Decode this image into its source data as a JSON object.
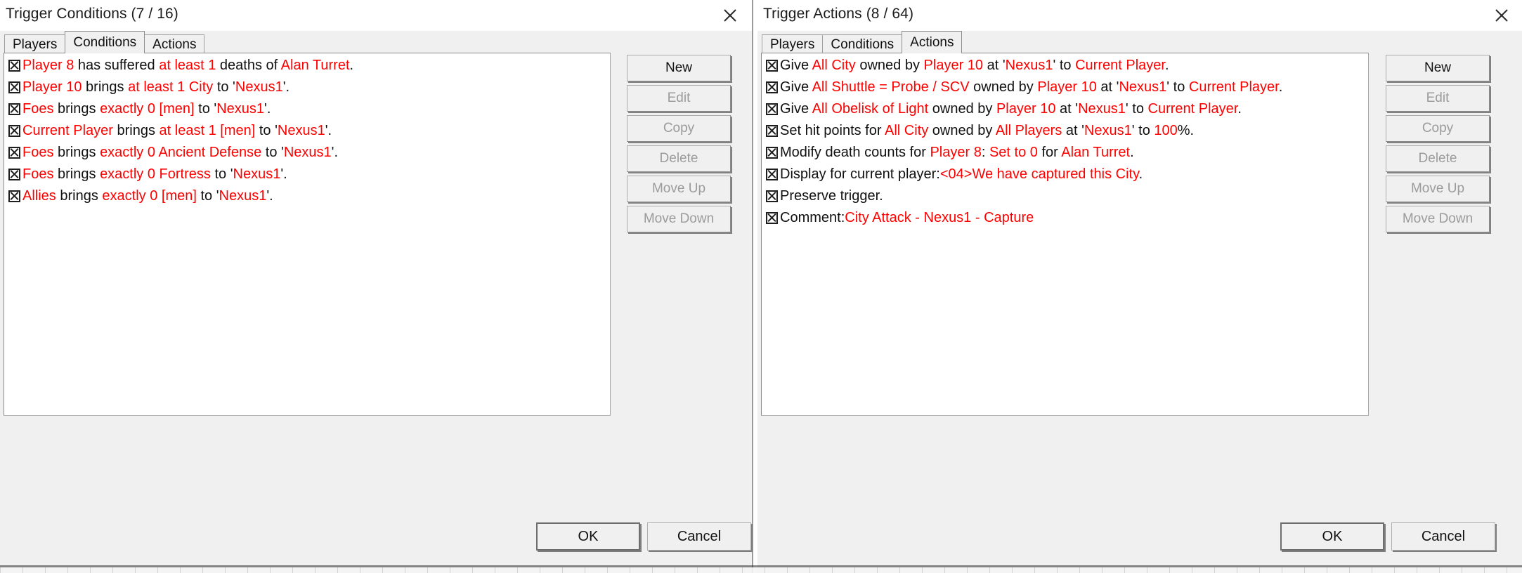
{
  "colors": {
    "accent_red": "#ff0000",
    "text": "#111111",
    "disabled_text": "#9b9b9b",
    "dialog_bg": "#f0f0f0",
    "list_bg": "#ffffff"
  },
  "conditions_dialog": {
    "title": "Trigger Conditions (7 / 16)",
    "close_label": "Close",
    "tabs": [
      {
        "label": "Players",
        "active": false
      },
      {
        "label": "Conditions",
        "active": true
      },
      {
        "label": "Actions",
        "active": false
      }
    ],
    "buttons": [
      {
        "label": "New",
        "enabled": true
      },
      {
        "label": "Edit",
        "enabled": false
      },
      {
        "label": "Copy",
        "enabled": false
      },
      {
        "label": "Delete",
        "enabled": false
      },
      {
        "label": "Move Up",
        "enabled": false
      },
      {
        "label": "Move Down",
        "enabled": false
      }
    ],
    "footer": {
      "ok": "OK",
      "cancel": "Cancel"
    },
    "rows": [
      {
        "checked": true,
        "parts": [
          {
            "t": "Player 8",
            "c": "r"
          },
          {
            "t": " has suffered ",
            "c": "k"
          },
          {
            "t": "at least",
            "c": "r"
          },
          {
            "t": " ",
            "c": "k"
          },
          {
            "t": "1",
            "c": "r"
          },
          {
            "t": " deaths of ",
            "c": "k"
          },
          {
            "t": "Alan Turret",
            "c": "r"
          },
          {
            "t": ".",
            "c": "k"
          }
        ]
      },
      {
        "checked": true,
        "parts": [
          {
            "t": "Player 10",
            "c": "r"
          },
          {
            "t": " brings ",
            "c": "k"
          },
          {
            "t": "at least",
            "c": "r"
          },
          {
            "t": " ",
            "c": "k"
          },
          {
            "t": "1 City",
            "c": "r"
          },
          {
            "t": " to '",
            "c": "k"
          },
          {
            "t": "Nexus1",
            "c": "r"
          },
          {
            "t": "'.",
            "c": "k"
          }
        ]
      },
      {
        "checked": true,
        "parts": [
          {
            "t": "Foes",
            "c": "r"
          },
          {
            "t": " brings ",
            "c": "k"
          },
          {
            "t": "exactly",
            "c": "r"
          },
          {
            "t": " ",
            "c": "k"
          },
          {
            "t": "0 [men]",
            "c": "r"
          },
          {
            "t": " to '",
            "c": "k"
          },
          {
            "t": "Nexus1",
            "c": "r"
          },
          {
            "t": "'.",
            "c": "k"
          }
        ]
      },
      {
        "checked": true,
        "parts": [
          {
            "t": "Current Player",
            "c": "r"
          },
          {
            "t": " brings ",
            "c": "k"
          },
          {
            "t": "at least",
            "c": "r"
          },
          {
            "t": " ",
            "c": "k"
          },
          {
            "t": "1 [men]",
            "c": "r"
          },
          {
            "t": " to '",
            "c": "k"
          },
          {
            "t": "Nexus1",
            "c": "r"
          },
          {
            "t": "'.",
            "c": "k"
          }
        ]
      },
      {
        "checked": true,
        "parts": [
          {
            "t": "Foes",
            "c": "r"
          },
          {
            "t": " brings ",
            "c": "k"
          },
          {
            "t": "exactly",
            "c": "r"
          },
          {
            "t": " ",
            "c": "k"
          },
          {
            "t": "0 Ancient Defense",
            "c": "r"
          },
          {
            "t": " to '",
            "c": "k"
          },
          {
            "t": "Nexus1",
            "c": "r"
          },
          {
            "t": "'.",
            "c": "k"
          }
        ]
      },
      {
        "checked": true,
        "parts": [
          {
            "t": "Foes",
            "c": "r"
          },
          {
            "t": " brings ",
            "c": "k"
          },
          {
            "t": "exactly",
            "c": "r"
          },
          {
            "t": " ",
            "c": "k"
          },
          {
            "t": "0 Fortress",
            "c": "r"
          },
          {
            "t": " to '",
            "c": "k"
          },
          {
            "t": "Nexus1",
            "c": "r"
          },
          {
            "t": "'.",
            "c": "k"
          }
        ]
      },
      {
        "checked": true,
        "parts": [
          {
            "t": "Allies",
            "c": "r"
          },
          {
            "t": " brings ",
            "c": "k"
          },
          {
            "t": "exactly",
            "c": "r"
          },
          {
            "t": " ",
            "c": "k"
          },
          {
            "t": "0 [men]",
            "c": "r"
          },
          {
            "t": " to '",
            "c": "k"
          },
          {
            "t": "Nexus1",
            "c": "r"
          },
          {
            "t": "'.",
            "c": "k"
          }
        ]
      }
    ]
  },
  "actions_dialog": {
    "title": "Trigger Actions (8 / 64)",
    "close_label": "Close",
    "tabs": [
      {
        "label": "Players",
        "active": false
      },
      {
        "label": "Conditions",
        "active": false
      },
      {
        "label": "Actions",
        "active": true
      }
    ],
    "buttons": [
      {
        "label": "New",
        "enabled": true
      },
      {
        "label": "Edit",
        "enabled": false
      },
      {
        "label": "Copy",
        "enabled": false
      },
      {
        "label": "Delete",
        "enabled": false
      },
      {
        "label": "Move Up",
        "enabled": false
      },
      {
        "label": "Move Down",
        "enabled": false
      }
    ],
    "footer": {
      "ok": "OK",
      "cancel": "Cancel"
    },
    "rows": [
      {
        "checked": true,
        "parts": [
          {
            "t": "Give ",
            "c": "k"
          },
          {
            "t": "All City",
            "c": "r"
          },
          {
            "t": " owned by ",
            "c": "k"
          },
          {
            "t": "Player 10",
            "c": "r"
          },
          {
            "t": " at '",
            "c": "k"
          },
          {
            "t": "Nexus1",
            "c": "r"
          },
          {
            "t": "' to ",
            "c": "k"
          },
          {
            "t": "Current Player",
            "c": "r"
          },
          {
            "t": ".",
            "c": "k"
          }
        ]
      },
      {
        "checked": true,
        "parts": [
          {
            "t": "Give ",
            "c": "k"
          },
          {
            "t": "All Shuttle = Probe / SCV",
            "c": "r"
          },
          {
            "t": " owned by ",
            "c": "k"
          },
          {
            "t": "Player 10",
            "c": "r"
          },
          {
            "t": " at '",
            "c": "k"
          },
          {
            "t": "Nexus1",
            "c": "r"
          },
          {
            "t": "' to ",
            "c": "k"
          },
          {
            "t": "Current Player",
            "c": "r"
          },
          {
            "t": ".",
            "c": "k"
          }
        ]
      },
      {
        "checked": true,
        "parts": [
          {
            "t": "Give ",
            "c": "k"
          },
          {
            "t": "All Obelisk of Light",
            "c": "r"
          },
          {
            "t": " owned by ",
            "c": "k"
          },
          {
            "t": "Player 10",
            "c": "r"
          },
          {
            "t": " at '",
            "c": "k"
          },
          {
            "t": "Nexus1",
            "c": "r"
          },
          {
            "t": "' to ",
            "c": "k"
          },
          {
            "t": "Current Player",
            "c": "r"
          },
          {
            "t": ".",
            "c": "k"
          }
        ]
      },
      {
        "checked": true,
        "parts": [
          {
            "t": "Set hit points for ",
            "c": "k"
          },
          {
            "t": "All City",
            "c": "r"
          },
          {
            "t": " owned by ",
            "c": "k"
          },
          {
            "t": "All Players",
            "c": "r"
          },
          {
            "t": " at '",
            "c": "k"
          },
          {
            "t": "Nexus1",
            "c": "r"
          },
          {
            "t": "' to ",
            "c": "k"
          },
          {
            "t": "100",
            "c": "r"
          },
          {
            "t": "%.",
            "c": "k"
          }
        ]
      },
      {
        "checked": true,
        "parts": [
          {
            "t": "Modify death counts for ",
            "c": "k"
          },
          {
            "t": "Player 8",
            "c": "r"
          },
          {
            "t": ": ",
            "c": "k"
          },
          {
            "t": "Set to 0",
            "c": "r"
          },
          {
            "t": " for ",
            "c": "k"
          },
          {
            "t": "Alan Turret",
            "c": "r"
          },
          {
            "t": ".",
            "c": "k"
          }
        ]
      },
      {
        "checked": true,
        "parts": [
          {
            "t": "Display for current player:",
            "c": "k"
          },
          {
            "t": "<04>We have captured this City",
            "c": "r"
          },
          {
            "t": ".",
            "c": "k"
          }
        ]
      },
      {
        "checked": true,
        "parts": [
          {
            "t": "Preserve trigger.",
            "c": "k"
          }
        ]
      },
      {
        "checked": true,
        "parts": [
          {
            "t": "Comment:",
            "c": "k"
          },
          {
            "t": "City Attack - Nexus1 - Capture",
            "c": "r"
          }
        ]
      }
    ]
  }
}
